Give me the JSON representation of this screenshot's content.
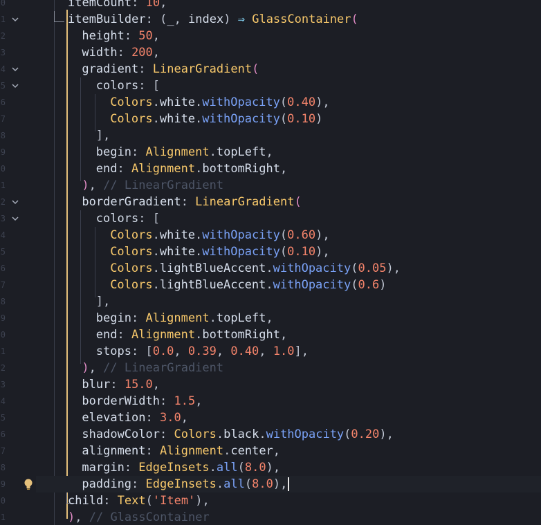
{
  "editor": {
    "language": "dart",
    "cursor_line": 29,
    "fold_marker_lines": [
      1,
      4,
      5,
      12,
      13
    ],
    "lightbulb_line": 29,
    "lines": [
      {
        "tokens": [
          [
            "prop",
            "itemCount"
          ],
          [
            "punc",
            ": "
          ],
          [
            "num",
            "10"
          ],
          [
            "punc",
            ","
          ]
        ]
      },
      {
        "tokens": [
          [
            "prop",
            "itemBuilder"
          ],
          [
            "punc",
            ": ("
          ],
          [
            "prop",
            "_"
          ],
          [
            "punc",
            ", "
          ],
          [
            "prop",
            "index"
          ],
          [
            "punc",
            ") "
          ],
          [
            "arrow",
            "⇒"
          ],
          [
            "punc",
            " "
          ],
          [
            "class",
            "GlassContainer"
          ],
          [
            "paren",
            "("
          ]
        ]
      },
      {
        "tokens": [
          [
            "prop",
            "height"
          ],
          [
            "punc",
            ": "
          ],
          [
            "num",
            "50"
          ],
          [
            "punc",
            ","
          ]
        ]
      },
      {
        "tokens": [
          [
            "prop",
            "width"
          ],
          [
            "punc",
            ": "
          ],
          [
            "num",
            "200"
          ],
          [
            "punc",
            ","
          ]
        ]
      },
      {
        "tokens": [
          [
            "prop",
            "gradient"
          ],
          [
            "punc",
            ": "
          ],
          [
            "class",
            "LinearGradient"
          ],
          [
            "paren",
            "("
          ]
        ]
      },
      {
        "tokens": [
          [
            "prop",
            "colors"
          ],
          [
            "punc",
            ": ["
          ]
        ]
      },
      {
        "tokens": [
          [
            "class",
            "Colors"
          ],
          [
            "punc",
            "."
          ],
          [
            "prop",
            "white"
          ],
          [
            "punc",
            "."
          ],
          [
            "fn",
            "withOpacity"
          ],
          [
            "punc",
            "("
          ],
          [
            "num",
            "0.40"
          ],
          [
            "punc",
            "),"
          ]
        ]
      },
      {
        "tokens": [
          [
            "class",
            "Colors"
          ],
          [
            "punc",
            "."
          ],
          [
            "prop",
            "white"
          ],
          [
            "punc",
            "."
          ],
          [
            "fn",
            "withOpacity"
          ],
          [
            "punc",
            "("
          ],
          [
            "num",
            "0.10"
          ],
          [
            "punc",
            ")"
          ]
        ]
      },
      {
        "tokens": [
          [
            "punc",
            "],"
          ]
        ]
      },
      {
        "tokens": [
          [
            "prop",
            "begin"
          ],
          [
            "punc",
            ": "
          ],
          [
            "class",
            "Alignment"
          ],
          [
            "punc",
            "."
          ],
          [
            "prop",
            "topLeft"
          ],
          [
            "punc",
            ","
          ]
        ]
      },
      {
        "tokens": [
          [
            "prop",
            "end"
          ],
          [
            "punc",
            ": "
          ],
          [
            "class",
            "Alignment"
          ],
          [
            "punc",
            "."
          ],
          [
            "prop",
            "bottomRight"
          ],
          [
            "punc",
            ","
          ]
        ]
      },
      {
        "tokens": [
          [
            "paren",
            ")"
          ],
          [
            "punc",
            ", "
          ],
          [
            "cmt",
            "// LinearGradient"
          ]
        ]
      },
      {
        "tokens": [
          [
            "prop",
            "borderGradient"
          ],
          [
            "punc",
            ": "
          ],
          [
            "class",
            "LinearGradient"
          ],
          [
            "paren",
            "("
          ]
        ]
      },
      {
        "tokens": [
          [
            "prop",
            "colors"
          ],
          [
            "punc",
            ": ["
          ]
        ]
      },
      {
        "tokens": [
          [
            "class",
            "Colors"
          ],
          [
            "punc",
            "."
          ],
          [
            "prop",
            "white"
          ],
          [
            "punc",
            "."
          ],
          [
            "fn",
            "withOpacity"
          ],
          [
            "punc",
            "("
          ],
          [
            "num",
            "0.60"
          ],
          [
            "punc",
            "),"
          ]
        ]
      },
      {
        "tokens": [
          [
            "class",
            "Colors"
          ],
          [
            "punc",
            "."
          ],
          [
            "prop",
            "white"
          ],
          [
            "punc",
            "."
          ],
          [
            "fn",
            "withOpacity"
          ],
          [
            "punc",
            "("
          ],
          [
            "num",
            "0.10"
          ],
          [
            "punc",
            "),"
          ]
        ]
      },
      {
        "tokens": [
          [
            "class",
            "Colors"
          ],
          [
            "punc",
            "."
          ],
          [
            "prop",
            "lightBlueAccent"
          ],
          [
            "punc",
            "."
          ],
          [
            "fn",
            "withOpacity"
          ],
          [
            "punc",
            "("
          ],
          [
            "num",
            "0.05"
          ],
          [
            "punc",
            "),"
          ]
        ]
      },
      {
        "tokens": [
          [
            "class",
            "Colors"
          ],
          [
            "punc",
            "."
          ],
          [
            "prop",
            "lightBlueAccent"
          ],
          [
            "punc",
            "."
          ],
          [
            "fn",
            "withOpacity"
          ],
          [
            "punc",
            "("
          ],
          [
            "num",
            "0.6"
          ],
          [
            "punc",
            ")"
          ]
        ]
      },
      {
        "tokens": [
          [
            "punc",
            "],"
          ]
        ]
      },
      {
        "tokens": [
          [
            "prop",
            "begin"
          ],
          [
            "punc",
            ": "
          ],
          [
            "class",
            "Alignment"
          ],
          [
            "punc",
            "."
          ],
          [
            "prop",
            "topLeft"
          ],
          [
            "punc",
            ","
          ]
        ]
      },
      {
        "tokens": [
          [
            "prop",
            "end"
          ],
          [
            "punc",
            ": "
          ],
          [
            "class",
            "Alignment"
          ],
          [
            "punc",
            "."
          ],
          [
            "prop",
            "bottomRight"
          ],
          [
            "punc",
            ","
          ]
        ]
      },
      {
        "tokens": [
          [
            "prop",
            "stops"
          ],
          [
            "punc",
            ": ["
          ],
          [
            "num",
            "0.0"
          ],
          [
            "punc",
            ", "
          ],
          [
            "num",
            "0.39"
          ],
          [
            "punc",
            ", "
          ],
          [
            "num",
            "0.40"
          ],
          [
            "punc",
            ", "
          ],
          [
            "num",
            "1.0"
          ],
          [
            "punc",
            "],"
          ]
        ]
      },
      {
        "tokens": [
          [
            "paren",
            ")"
          ],
          [
            "punc",
            ", "
          ],
          [
            "cmt",
            "// LinearGradient"
          ]
        ]
      },
      {
        "tokens": [
          [
            "prop",
            "blur"
          ],
          [
            "punc",
            ": "
          ],
          [
            "num",
            "15.0"
          ],
          [
            "punc",
            ","
          ]
        ]
      },
      {
        "tokens": [
          [
            "prop",
            "borderWidth"
          ],
          [
            "punc",
            ": "
          ],
          [
            "num",
            "1.5"
          ],
          [
            "punc",
            ","
          ]
        ]
      },
      {
        "tokens": [
          [
            "prop",
            "elevation"
          ],
          [
            "punc",
            ": "
          ],
          [
            "num",
            "3.0"
          ],
          [
            "punc",
            ","
          ]
        ]
      },
      {
        "tokens": [
          [
            "prop",
            "shadowColor"
          ],
          [
            "punc",
            ": "
          ],
          [
            "class",
            "Colors"
          ],
          [
            "punc",
            "."
          ],
          [
            "prop",
            "black"
          ],
          [
            "punc",
            "."
          ],
          [
            "fn",
            "withOpacity"
          ],
          [
            "punc",
            "("
          ],
          [
            "num",
            "0.20"
          ],
          [
            "punc",
            "),"
          ]
        ]
      },
      {
        "tokens": [
          [
            "prop",
            "alignment"
          ],
          [
            "punc",
            ": "
          ],
          [
            "class",
            "Alignment"
          ],
          [
            "punc",
            "."
          ],
          [
            "prop",
            "center"
          ],
          [
            "punc",
            ","
          ]
        ]
      },
      {
        "tokens": [
          [
            "prop",
            "margin"
          ],
          [
            "punc",
            ": "
          ],
          [
            "class",
            "EdgeInsets"
          ],
          [
            "punc",
            "."
          ],
          [
            "fn",
            "all"
          ],
          [
            "punc",
            "("
          ],
          [
            "num",
            "8.0"
          ],
          [
            "punc",
            "),"
          ]
        ]
      },
      {
        "tokens": [
          [
            "prop",
            "padding"
          ],
          [
            "punc",
            ": "
          ],
          [
            "class",
            "EdgeInsets"
          ],
          [
            "punc",
            "."
          ],
          [
            "fn",
            "all"
          ],
          [
            "punc",
            "("
          ],
          [
            "num",
            "8.0"
          ],
          [
            "punc",
            "),"
          ]
        ]
      },
      {
        "tokens": [
          [
            "prop",
            "child"
          ],
          [
            "punc",
            ": "
          ],
          [
            "class",
            "Text"
          ],
          [
            "punc",
            "("
          ],
          [
            "str",
            "'Item'"
          ],
          [
            "punc",
            "),"
          ]
        ]
      },
      {
        "tokens": [
          [
            "paren",
            ")"
          ],
          [
            "punc",
            ", "
          ],
          [
            "cmt",
            "// GlassContainer"
          ]
        ]
      }
    ]
  },
  "colors": {
    "background": "#1c1e25",
    "class": "#f7c86b",
    "number": "#f4846b",
    "method": "#7aa2f7",
    "comment": "#4d5566",
    "paren": "#e08cc5",
    "active_guide": "#e5c07b"
  },
  "icons": {
    "fold": "chevron-down-icon",
    "lightbulb": "lightbulb-icon"
  }
}
